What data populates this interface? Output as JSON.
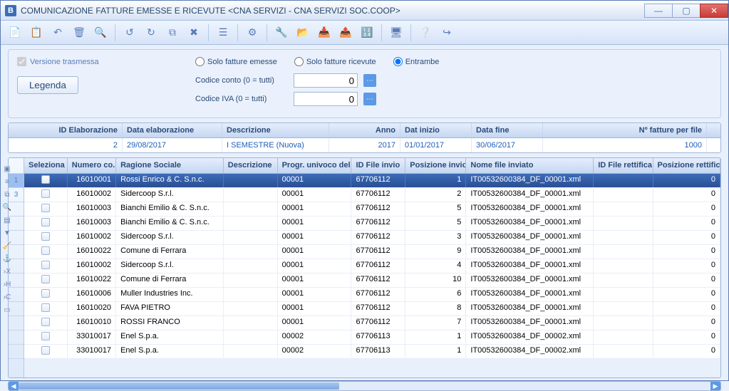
{
  "window": {
    "icon_letter": "B",
    "title": "COMUNICAZIONE FATTURE EMESSE E RICEVUTE <CNA SERVIZI - CNA SERVIZI SOC.COOP>"
  },
  "toolbar": {
    "icons": [
      "new",
      "save",
      "undo",
      "delete",
      "find",
      "cut",
      "copy",
      "paste",
      "clear",
      "list",
      "settings",
      "tool",
      "folder",
      "import",
      "export",
      "grid",
      "screen",
      "help",
      "exit"
    ]
  },
  "filter": {
    "versione_trasmessa": "Versione trasmessa",
    "legenda": "Legenda",
    "radio_emesse": "Solo fatture emesse",
    "radio_ricevute": "Solo fatture ricevute",
    "radio_entrambe": "Entrambe",
    "codice_conto_label": "Codice conto (0 = tutti)",
    "codice_conto_value": "0",
    "codice_iva_label": "Codice IVA (0 = tutti)",
    "codice_iva_value": "0"
  },
  "summary": {
    "headers": {
      "id": "ID Elaborazione",
      "data": "Data elaborazione",
      "desc": "Descrizione",
      "anno": "Anno",
      "dini": "Dat inizio",
      "dfin": "Data fine",
      "nfat": "Nº fatture per file"
    },
    "row": {
      "id": "2",
      "data": "29/08/2017",
      "desc": "I SEMESTRE (Nuova)",
      "anno": "2017",
      "dini": "01/01/2017",
      "dfin": "30/06/2017",
      "nfat": "1000"
    }
  },
  "grid": {
    "headers": {
      "sel": "Seleziona",
      "num": "Numero co...",
      "rag": "Ragione Sociale",
      "desc": "Descrizione",
      "progr": "Progr. univoco del file",
      "idfile": "ID File invio",
      "pos": "Posizione invio",
      "nome": "Nome file inviato",
      "idrett": "ID File rettifica",
      "posrett": "Posizione rettifica"
    },
    "row_handles_top": [
      "1",
      "3"
    ],
    "rows": [
      {
        "num": "16010001",
        "rag": "Rossi Enrico & C. S.n.c.",
        "progr": "00001",
        "idfile": "67706112",
        "pos": "1",
        "nome": "IT00532600384_DF_00001.xml",
        "posrett": "0",
        "selected": true
      },
      {
        "num": "16010002",
        "rag": "Sidercoop S.r.l.",
        "progr": "00001",
        "idfile": "67706112",
        "pos": "2",
        "nome": "IT00532600384_DF_00001.xml",
        "posrett": "0"
      },
      {
        "num": "16010003",
        "rag": "Bianchi Emilio & C. S.n.c.",
        "progr": "00001",
        "idfile": "67706112",
        "pos": "5",
        "nome": "IT00532600384_DF_00001.xml",
        "posrett": "0"
      },
      {
        "num": "16010003",
        "rag": "Bianchi Emilio & C. S.n.c.",
        "progr": "00001",
        "idfile": "67706112",
        "pos": "5",
        "nome": "IT00532600384_DF_00001.xml",
        "posrett": "0"
      },
      {
        "num": "16010002",
        "rag": "Sidercoop S.r.l.",
        "progr": "00001",
        "idfile": "67706112",
        "pos": "3",
        "nome": "IT00532600384_DF_00001.xml",
        "posrett": "0"
      },
      {
        "num": "16010022",
        "rag": "Comune di Ferrara",
        "progr": "00001",
        "idfile": "67706112",
        "pos": "9",
        "nome": "IT00532600384_DF_00001.xml",
        "posrett": "0"
      },
      {
        "num": "16010002",
        "rag": "Sidercoop S.r.l.",
        "progr": "00001",
        "idfile": "67706112",
        "pos": "4",
        "nome": "IT00532600384_DF_00001.xml",
        "posrett": "0"
      },
      {
        "num": "16010022",
        "rag": "Comune di Ferrara",
        "progr": "00001",
        "idfile": "67706112",
        "pos": "10",
        "nome": "IT00532600384_DF_00001.xml",
        "posrett": "0"
      },
      {
        "num": "16010006",
        "rag": "Muller Industries Inc.",
        "progr": "00001",
        "idfile": "67706112",
        "pos": "6",
        "nome": "IT00532600384_DF_00001.xml",
        "posrett": "0"
      },
      {
        "num": "16010020",
        "rag": "FAVA PIETRO",
        "progr": "00001",
        "idfile": "67706112",
        "pos": "8",
        "nome": "IT00532600384_DF_00001.xml",
        "posrett": "0"
      },
      {
        "num": "16010010",
        "rag": "ROSSI FRANCO",
        "progr": "00001",
        "idfile": "67706112",
        "pos": "7",
        "nome": "IT00532600384_DF_00001.xml",
        "posrett": "0"
      },
      {
        "num": "33010017",
        "rag": "Enel S.p.a.",
        "progr": "00002",
        "idfile": "67706113",
        "pos": "1",
        "nome": "IT00532600384_DF_00002.xml",
        "posrett": "0"
      },
      {
        "num": "33010017",
        "rag": "Enel S.p.a.",
        "progr": "00002",
        "idfile": "67706113",
        "pos": "1",
        "nome": "IT00532600384_DF_00002.xml",
        "posrett": "0"
      }
    ]
  }
}
